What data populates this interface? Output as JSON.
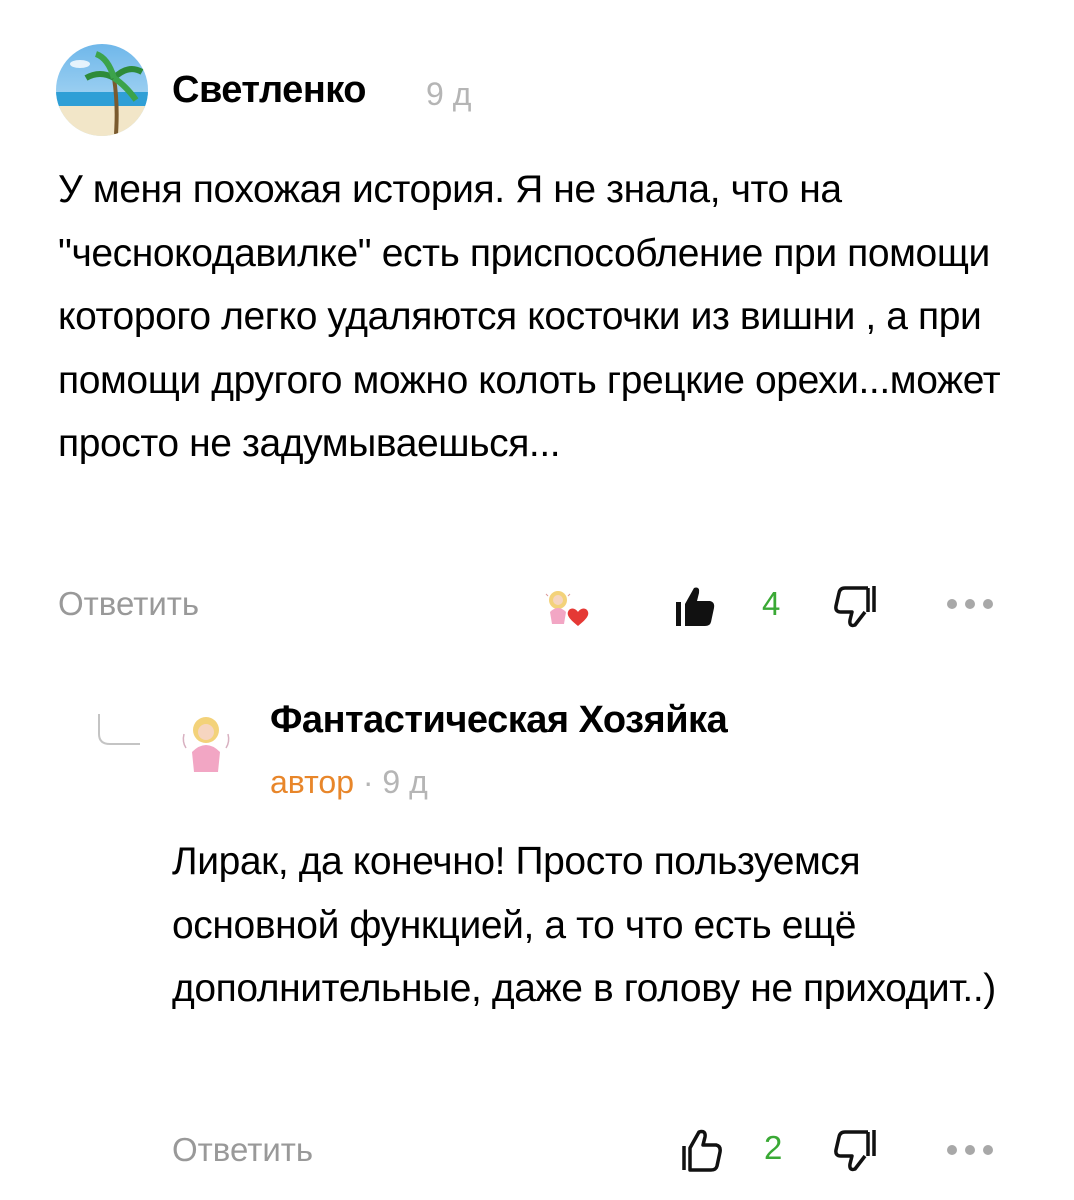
{
  "comment": {
    "author": "Светленко",
    "time": "9 д",
    "text": "У меня похожая история. Я не знала, что на \"чеснокодавилке\" есть приспособление при помощи которого легко удаляются косточки из вишни , а при помощи другого можно колоть грецкие орехи...может просто не задумываешься...",
    "reply_label": "Ответить",
    "likes": "4",
    "author_liked": true,
    "liked_by_viewer": true
  },
  "reply": {
    "author": "Фантастическая Хозяйка",
    "badge": "автор",
    "separator": "·",
    "time": "9 д",
    "text": "Лирак, да конечно! Просто пользуемся основной функцией, а то что есть ещё дополнительные, даже в голову не приходит..)",
    "reply_label": "Ответить",
    "likes": "2",
    "liked_by_viewer": false
  },
  "colors": {
    "like_count": "#3aa935",
    "author_badge": "#e8862a",
    "muted": "#999999",
    "heart": "#e53935"
  },
  "icons": {
    "like": "thumbs-up-icon",
    "dislike": "thumbs-down-icon",
    "more": "more-dots-icon",
    "heart": "heart-icon",
    "thread": "thread-branch-icon"
  }
}
